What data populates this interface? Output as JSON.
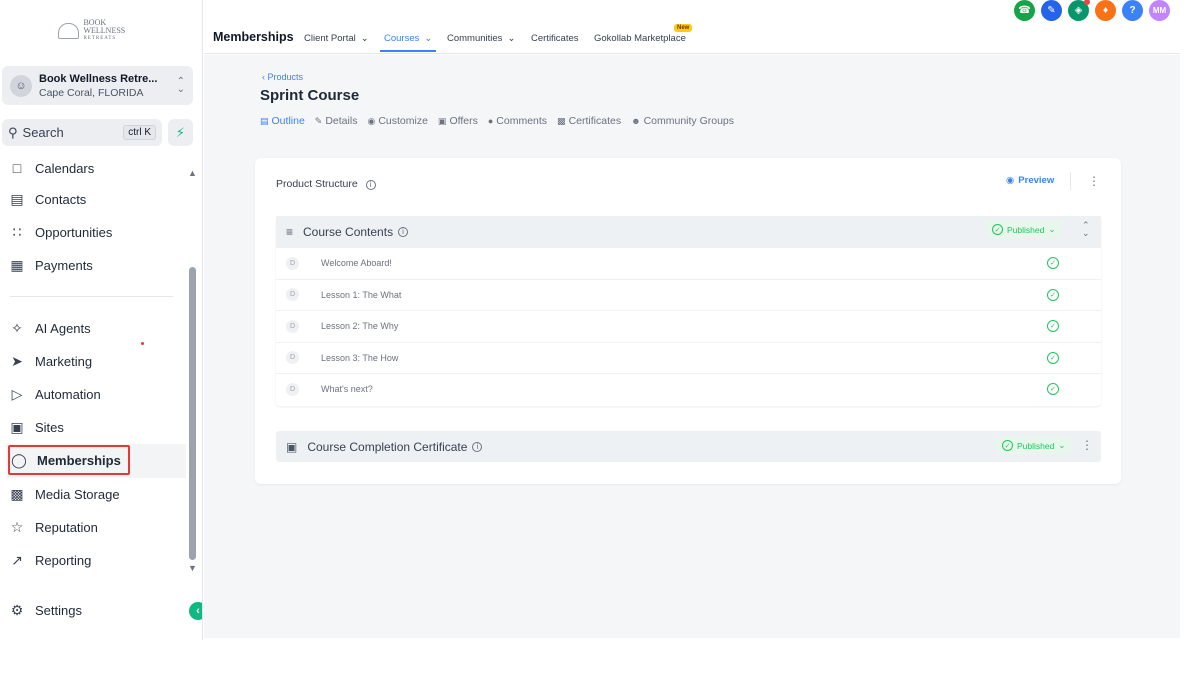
{
  "sidebar": {
    "logo": {
      "line1": "BOOK WELLNESS",
      "line2": "RETREATS"
    },
    "account": {
      "name": "Book Wellness Retre...",
      "location": "Cape Coral, FLORIDA"
    },
    "search": {
      "placeholder": "Search",
      "shortcut": "ctrl K"
    },
    "items": [
      {
        "label": "Calendars",
        "icon": "calendar-icon"
      },
      {
        "label": "Contacts",
        "icon": "contacts-icon"
      },
      {
        "label": "Opportunities",
        "icon": "opportunities-icon"
      },
      {
        "label": "Payments",
        "icon": "payments-icon"
      },
      {
        "label": "AI Agents",
        "icon": "sparkle-icon"
      },
      {
        "label": "Marketing",
        "icon": "send-icon"
      },
      {
        "label": "Automation",
        "icon": "automation-icon"
      },
      {
        "label": "Sites",
        "icon": "sites-icon"
      },
      {
        "label": "Memberships",
        "icon": "award-icon"
      },
      {
        "label": "Media Storage",
        "icon": "image-icon"
      },
      {
        "label": "Reputation",
        "icon": "star-icon"
      },
      {
        "label": "Reporting",
        "icon": "trend-icon"
      },
      {
        "label": "Settings",
        "icon": "gear-icon"
      }
    ]
  },
  "topbar": {
    "title": "Memberships",
    "tabs": [
      {
        "label": "Client Portal",
        "dropdown": true
      },
      {
        "label": "Courses",
        "dropdown": true
      },
      {
        "label": "Communities",
        "dropdown": true
      },
      {
        "label": "Certificates",
        "dropdown": false
      },
      {
        "label": "Gokollab Marketplace",
        "dropdown": false
      }
    ],
    "new_badge": "New",
    "user_initials": "MM",
    "help_label": "?"
  },
  "main": {
    "breadcrumb": "Products",
    "title": "Sprint Course",
    "subtabs": [
      "Outline",
      "Details",
      "Customize",
      "Offers",
      "Comments",
      "Certificates",
      "Community Groups"
    ],
    "structure_label": "Product Structure",
    "preview_label": "Preview",
    "section": {
      "title": "Course Contents",
      "status": "Published",
      "lessons": [
        {
          "badge": "D",
          "title": "Welcome Aboard!"
        },
        {
          "badge": "D",
          "title": "Lesson 1: The What"
        },
        {
          "badge": "D",
          "title": "Lesson 2: The Why"
        },
        {
          "badge": "D",
          "title": "Lesson 3: The How"
        },
        {
          "badge": "D",
          "title": "What's next?"
        }
      ]
    },
    "certificate": {
      "title": "Course Completion Certificate",
      "status": "Published"
    }
  },
  "colors": {
    "accent": "#3b82f6",
    "success": "#22c55e",
    "highlight_border": "#e53935"
  }
}
